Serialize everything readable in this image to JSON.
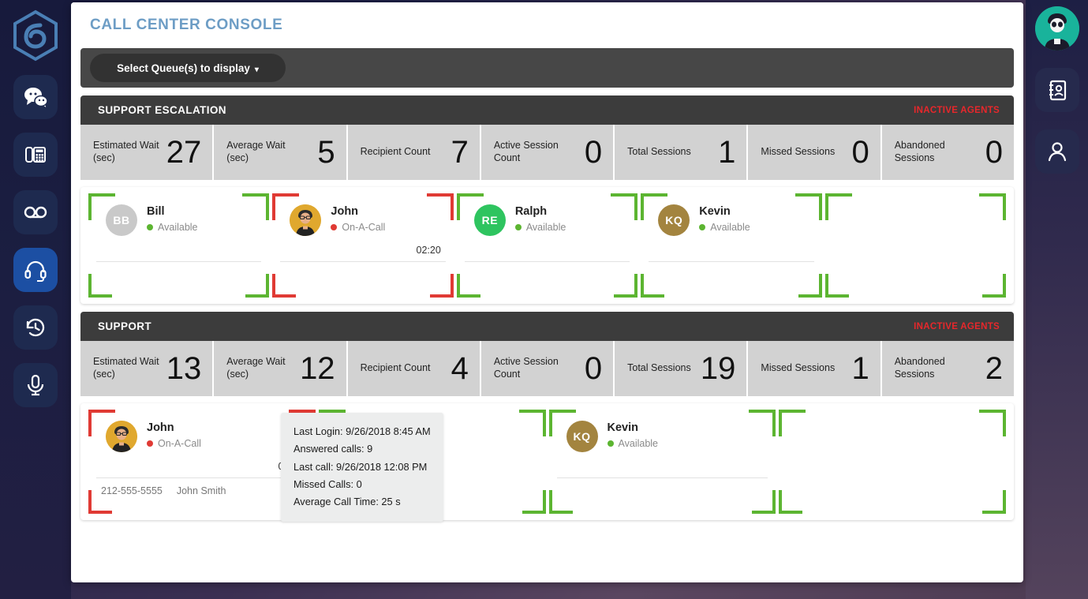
{
  "window": {
    "title": "CALL CENTER CONSOLE"
  },
  "selector": {
    "queue_button_label": "Select Queue(s) to display",
    "caret": "▾"
  },
  "left_rail": {
    "logo_name": "brand-hex-logo",
    "items": [
      {
        "icon": "chat-bubbles-icon",
        "active": false
      },
      {
        "icon": "desk-phone-icon",
        "active": false
      },
      {
        "icon": "voicemail-icon",
        "active": false
      },
      {
        "icon": "headset-icon",
        "active": true
      },
      {
        "icon": "call-history-icon",
        "active": false
      },
      {
        "icon": "microphone-icon",
        "active": false
      }
    ]
  },
  "right_rail": {
    "avatar_name": "user-avatar",
    "items": [
      {
        "icon": "contacts-book-icon"
      },
      {
        "icon": "person-icon"
      }
    ]
  },
  "stat_labels": [
    "Estimated Wait (sec)",
    "Average Wait (sec)",
    "Recipient Count",
    "Active Session Count",
    "Total Sessions",
    "Missed Sessions",
    "Abandoned Sessions"
  ],
  "inactive_agents_label": "INACTIVE AGENTS",
  "colors": {
    "available": "#5cb531",
    "on_call": "#e03a34",
    "title": "#6d9dc5",
    "inactive_link": "#e8272b",
    "panel_head": "#3c3c3c",
    "stats_bg": "#d2d2d2"
  },
  "queues": [
    {
      "name": "SUPPORT ESCALATION",
      "stats": {
        "estimated_wait": "27",
        "average_wait": "5",
        "recipient_count": "7",
        "active_session_count": "0",
        "total_sessions": "1",
        "missed_sessions": "0",
        "abandoned_sessions": "0"
      },
      "agents": [
        {
          "name": "Bill",
          "status": "Available",
          "state": "green",
          "initials": "BB",
          "avatar_type": "initials",
          "avatar_bg": "#c9c9c9",
          "timer": "",
          "phone": "",
          "caller": ""
        },
        {
          "name": "John",
          "status": "On-A-Call",
          "state": "red",
          "initials": "",
          "avatar_type": "photo",
          "avatar_bg": "#e0a82e",
          "timer": "02:20",
          "phone": "",
          "caller": ""
        },
        {
          "name": "Ralph",
          "status": "Available",
          "state": "green",
          "initials": "RE",
          "avatar_type": "initials",
          "avatar_bg": "#2ec45f",
          "timer": "",
          "phone": "",
          "caller": ""
        },
        {
          "name": "Kevin",
          "status": "Available",
          "state": "green",
          "initials": "KQ",
          "avatar_type": "initials",
          "avatar_bg": "#a3843f",
          "timer": "",
          "phone": "",
          "caller": ""
        },
        {
          "name": "",
          "status": "",
          "state": "green",
          "initials": "",
          "avatar_type": "none",
          "avatar_bg": "",
          "timer": "",
          "phone": "",
          "caller": ""
        }
      ]
    },
    {
      "name": "SUPPORT",
      "stats": {
        "estimated_wait": "13",
        "average_wait": "12",
        "recipient_count": "4",
        "active_session_count": "0",
        "total_sessions": "19",
        "missed_sessions": "1",
        "abandoned_sessions": "2"
      },
      "agents": [
        {
          "name": "John",
          "status": "On-A-Call",
          "state": "red",
          "initials": "",
          "avatar_type": "photo",
          "avatar_bg": "#e0a82e",
          "timer": "02:20",
          "phone": "212-555-5555",
          "caller": "John Smith"
        },
        {
          "name": "",
          "status": "",
          "state": "green",
          "initials": "",
          "avatar_type": "none",
          "avatar_bg": "",
          "timer": "",
          "phone": "",
          "caller": ""
        },
        {
          "name": "Kevin",
          "status": "Available",
          "state": "green",
          "initials": "KQ",
          "avatar_type": "initials",
          "avatar_bg": "#a3843f",
          "timer": "",
          "phone": "",
          "caller": ""
        },
        {
          "name": "",
          "status": "",
          "state": "green",
          "initials": "",
          "avatar_type": "none",
          "avatar_bg": "",
          "timer": "",
          "phone": "",
          "caller": ""
        }
      ],
      "tooltip": {
        "last_login": "Last Login: 9/26/2018 8:45 AM",
        "answered_calls": "Answered calls: 9",
        "last_call": "Last call: 9/26/2018 12:08 PM",
        "missed_calls": "Missed Calls: 0",
        "average_call_time": "Average Call Time: 25 s"
      }
    }
  ]
}
